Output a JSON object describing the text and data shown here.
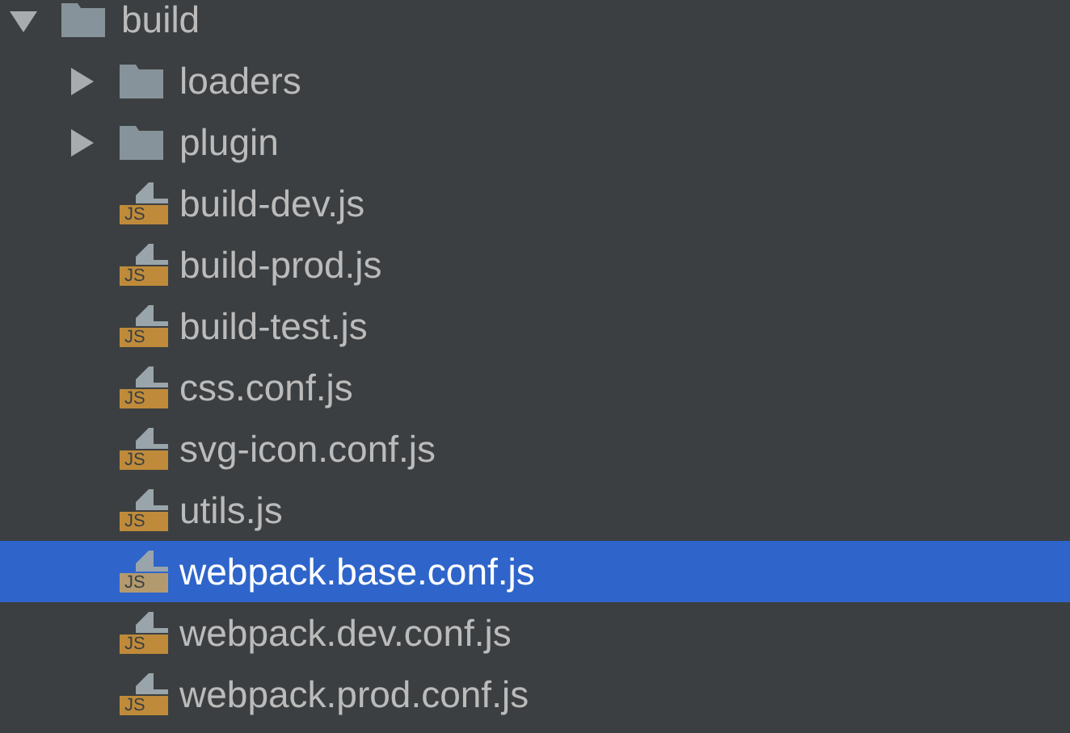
{
  "tree": [
    {
      "kind": "folder",
      "name": "build",
      "expanded": true,
      "selected": false,
      "children": [
        {
          "kind": "folder",
          "name": "loaders",
          "expanded": false,
          "selected": false
        },
        {
          "kind": "folder",
          "name": "plugin",
          "expanded": false,
          "selected": false
        },
        {
          "kind": "file",
          "name": "build-dev.js",
          "badge": "JS",
          "selected": false
        },
        {
          "kind": "file",
          "name": "build-prod.js",
          "badge": "JS",
          "selected": false
        },
        {
          "kind": "file",
          "name": "build-test.js",
          "badge": "JS",
          "selected": false
        },
        {
          "kind": "file",
          "name": "css.conf.js",
          "badge": "JS",
          "selected": false
        },
        {
          "kind": "file",
          "name": "svg-icon.conf.js",
          "badge": "JS",
          "selected": false
        },
        {
          "kind": "file",
          "name": "utils.js",
          "badge": "JS",
          "selected": false
        },
        {
          "kind": "file",
          "name": "webpack.base.conf.js",
          "badge": "JS",
          "selected": true
        },
        {
          "kind": "file",
          "name": "webpack.dev.conf.js",
          "badge": "JS",
          "selected": false
        },
        {
          "kind": "file",
          "name": "webpack.prod.conf.js",
          "badge": "JS",
          "selected": false
        }
      ]
    }
  ]
}
